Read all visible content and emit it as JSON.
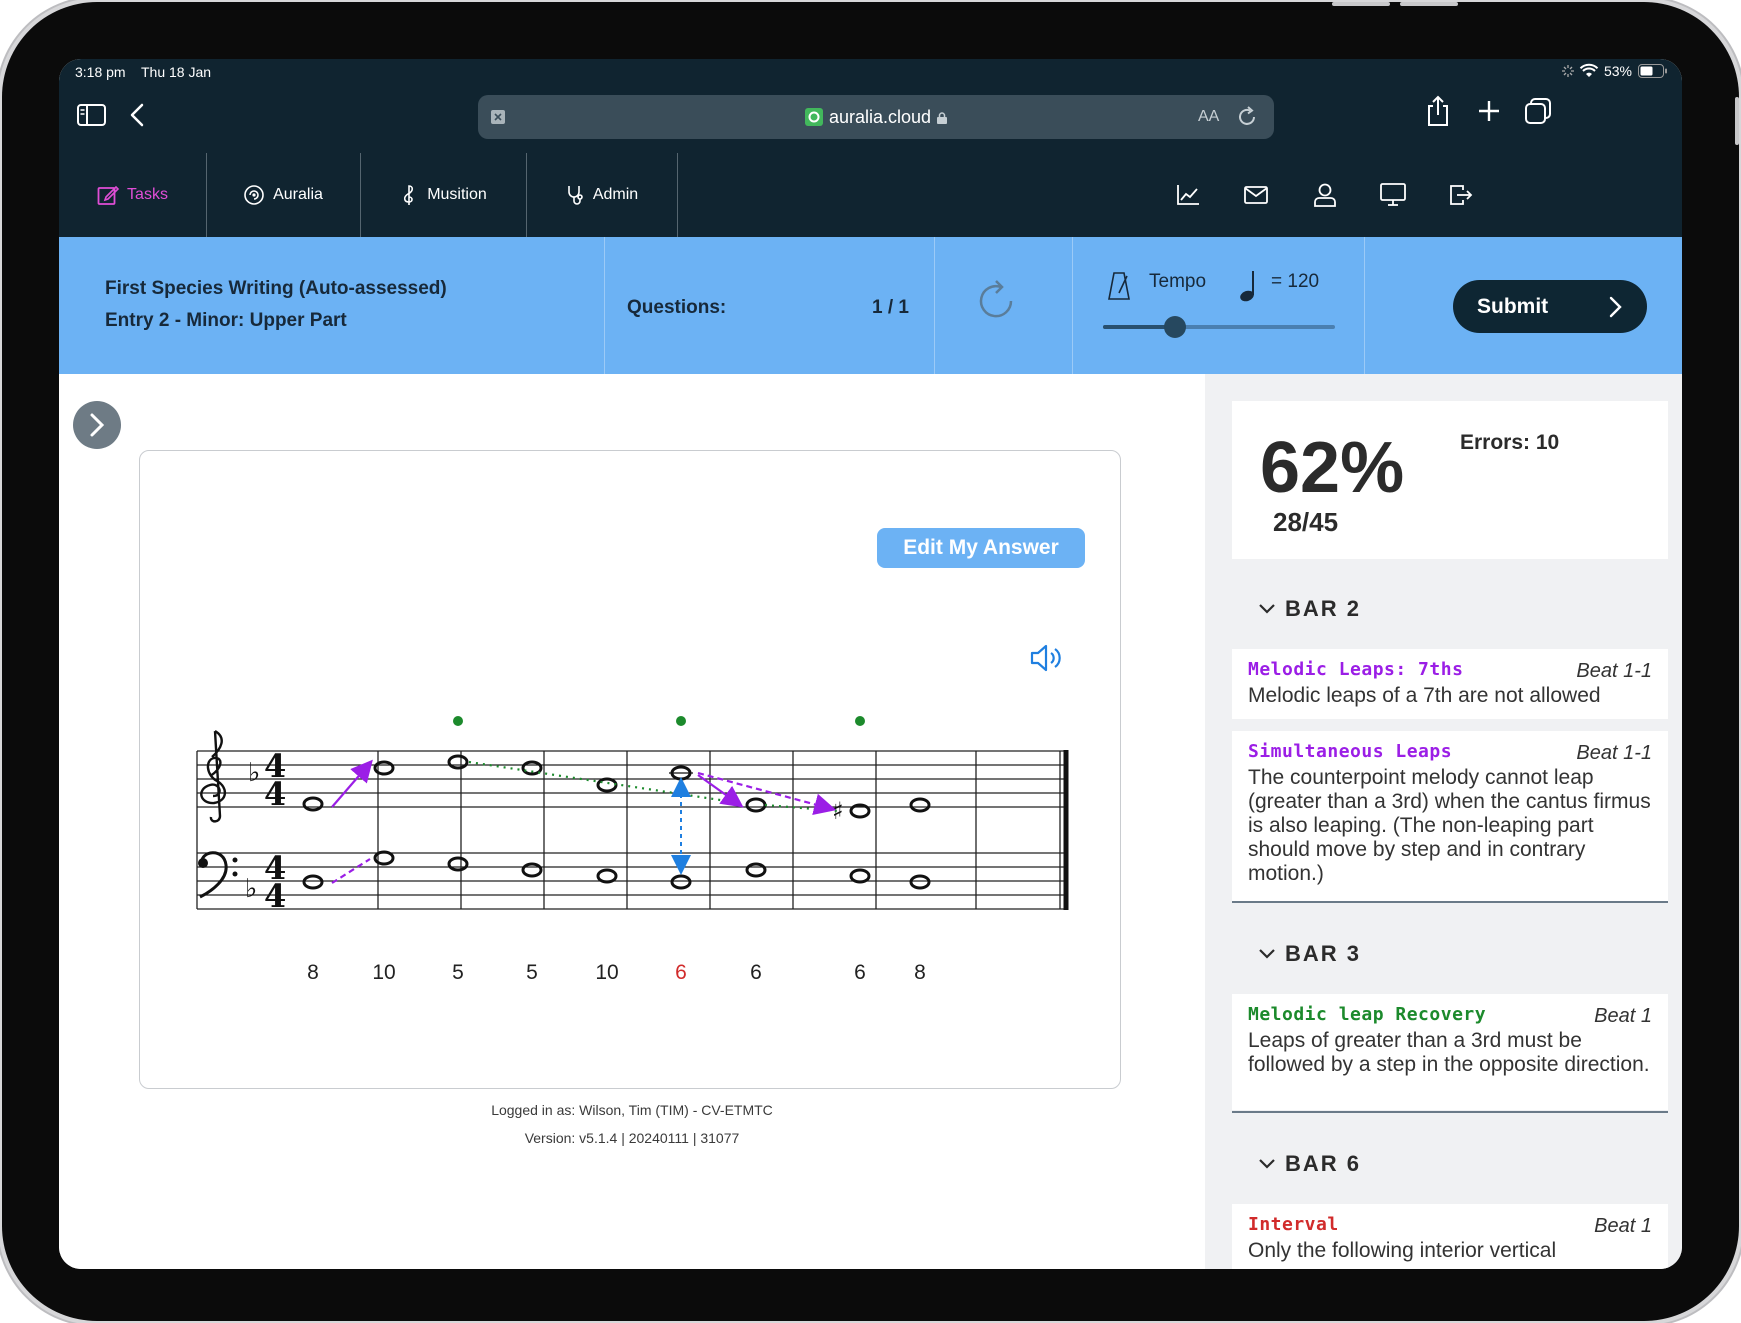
{
  "status": {
    "time": "3:18 pm",
    "date": "Thu 18 Jan",
    "battery": "53%"
  },
  "browser": {
    "url": "auralia.cloud",
    "text_size": "AA"
  },
  "nav": {
    "tabs": [
      {
        "label": "Tasks"
      },
      {
        "label": "Auralia"
      },
      {
        "label": "Musition"
      },
      {
        "label": "Admin"
      }
    ],
    "icons": [
      "chart-icon",
      "mail-icon",
      "user-icon",
      "monitor-icon",
      "logout-icon"
    ]
  },
  "task": {
    "title_line1": "First Species Writing (Auto-assessed)",
    "title_line2": "Entry 2 - Minor: Upper Part",
    "questions_label": "Questions:",
    "questions_value": "1 / 1",
    "tempo_label": "Tempo",
    "tempo_value": "= 120",
    "tempo_level": 0.31,
    "submit_label": "Submit"
  },
  "score_card": {
    "edit_label": "Edit My Answer"
  },
  "figured_bass": [
    {
      "text": "8",
      "color": "#222222"
    },
    {
      "text": "10",
      "color": "#222222"
    },
    {
      "text": "5",
      "color": "#222222"
    },
    {
      "text": "5",
      "color": "#222222"
    },
    {
      "text": "10",
      "color": "#222222"
    },
    {
      "text": "6",
      "color": "#d12b2b"
    },
    {
      "text": "6",
      "color": "#222222"
    },
    {
      "text": "6",
      "color": "#222222"
    },
    {
      "text": "8",
      "color": "#222222"
    }
  ],
  "footer": {
    "logged_in": "Logged in as: Wilson, Tim (TIM) - CV-ETMTC",
    "version": "Version: v5.1.4 | 20240111 | 31077"
  },
  "results": {
    "percent": "62%",
    "fraction": "28/45",
    "errors": "Errors: 10",
    "bars": [
      {
        "label": "BAR 2",
        "items": [
          {
            "title": "Melodic Leaps: 7ths",
            "color": "#9b1ee6",
            "beat": "Beat 1-1",
            "desc": "Melodic leaps of a 7th are not allowed"
          },
          {
            "title": "Simultaneous Leaps",
            "color": "#9b1ee6",
            "beat": "Beat 1-1",
            "desc": "The counterpoint melody cannot leap (greater than a 3rd) when the cantus firmus is also leaping. (The non-leaping part should move by step and in contrary motion.)"
          }
        ]
      },
      {
        "label": "BAR 3",
        "items": [
          {
            "title": "Melodic leap Recovery",
            "color": "#1c8a2c",
            "beat": "Beat 1",
            "desc": "Leaps of greater than a 3rd must be followed by a step in the opposite direction."
          }
        ]
      },
      {
        "label": "BAR 6",
        "items": [
          {
            "title": "Interval",
            "color": "#d12b2b",
            "beat": "Beat 1",
            "desc": "Only the following interior vertical"
          }
        ]
      }
    ]
  },
  "colors": {
    "nav_bg": "#102430",
    "task_bar": "#6cb2f4",
    "active_tab": "#e04ed6",
    "leap_arrow": "#9b1ee6",
    "interval_arrow": "#1f7fe0",
    "recovery_dots": "#1c8a2c"
  }
}
